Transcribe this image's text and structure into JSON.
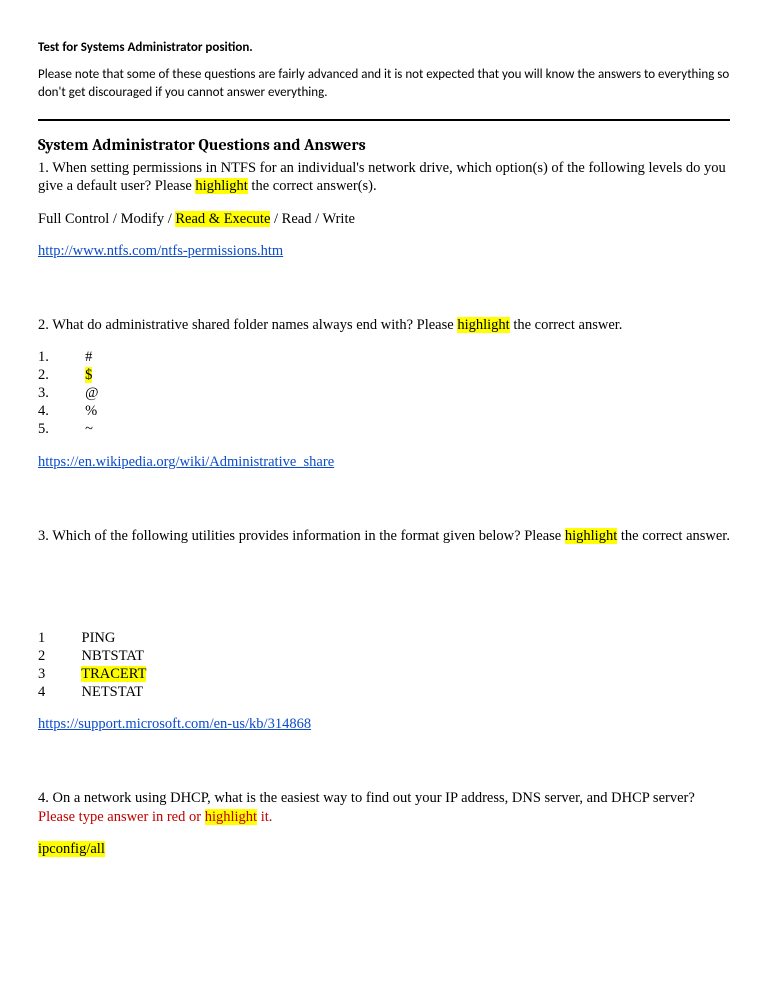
{
  "intro": {
    "title": "Test for Systems Administrator position.",
    "body": "Please note that some of these questions are fairly advanced and it is not expected that you will know the answers to everything so don't get discouraged if you cannot answer everything."
  },
  "heading": "System Administrator Questions and Answers",
  "q1": {
    "text_a": "1.  When setting permissions in NTFS for an individual's network drive, which option(s) of the following levels do you give a default user?  Please ",
    "hl": "highlight",
    "text_b": " the correct answer(s).",
    "options_a": "Full Control / Modify / ",
    "options_hl": "Read & Execute",
    "options_b": " / Read / Write",
    "link": "http://www.ntfs.com/ntfs-permissions.htm"
  },
  "q2": {
    "text_a": "2. What do administrative shared folder names always end with? Please ",
    "hl": "highlight",
    "text_b": " the correct answer.",
    "opts": [
      {
        "n": "1.",
        "v": "#",
        "hl": false
      },
      {
        "n": "2.",
        "v": "$",
        "hl": true
      },
      {
        "n": "3.",
        "v": "@",
        "hl": false
      },
      {
        "n": "4.",
        "v": "%",
        "hl": false
      },
      {
        "n": "5.",
        "v": "~",
        "hl": false
      }
    ],
    "link": "https://en.wikipedia.org/wiki/Administrative_share"
  },
  "q3": {
    "text_a": "3.  Which of the following utilities provides information in the format given below?  Please ",
    "hl": "highlight",
    "text_b": " the correct answer.",
    "opts": [
      {
        "n": "1",
        "v": "PING",
        "hl": false
      },
      {
        "n": "2",
        "v": "NBTSTAT",
        "hl": false
      },
      {
        "n": "3",
        "v": "TRACERT",
        "hl": true
      },
      {
        "n": "4",
        "v": "NETSTAT",
        "hl": false
      }
    ],
    "link": "https://support.microsoft.com/en-us/kb/314868"
  },
  "q4": {
    "text_a": "4.  On a network using DHCP, what is the easiest way to find out your IP address, DNS server, and DHCP server?  ",
    "red_a": "Please type answer in red or ",
    "hl": "highlight",
    "red_b": " it.",
    "answer": "ipconfig/all"
  }
}
